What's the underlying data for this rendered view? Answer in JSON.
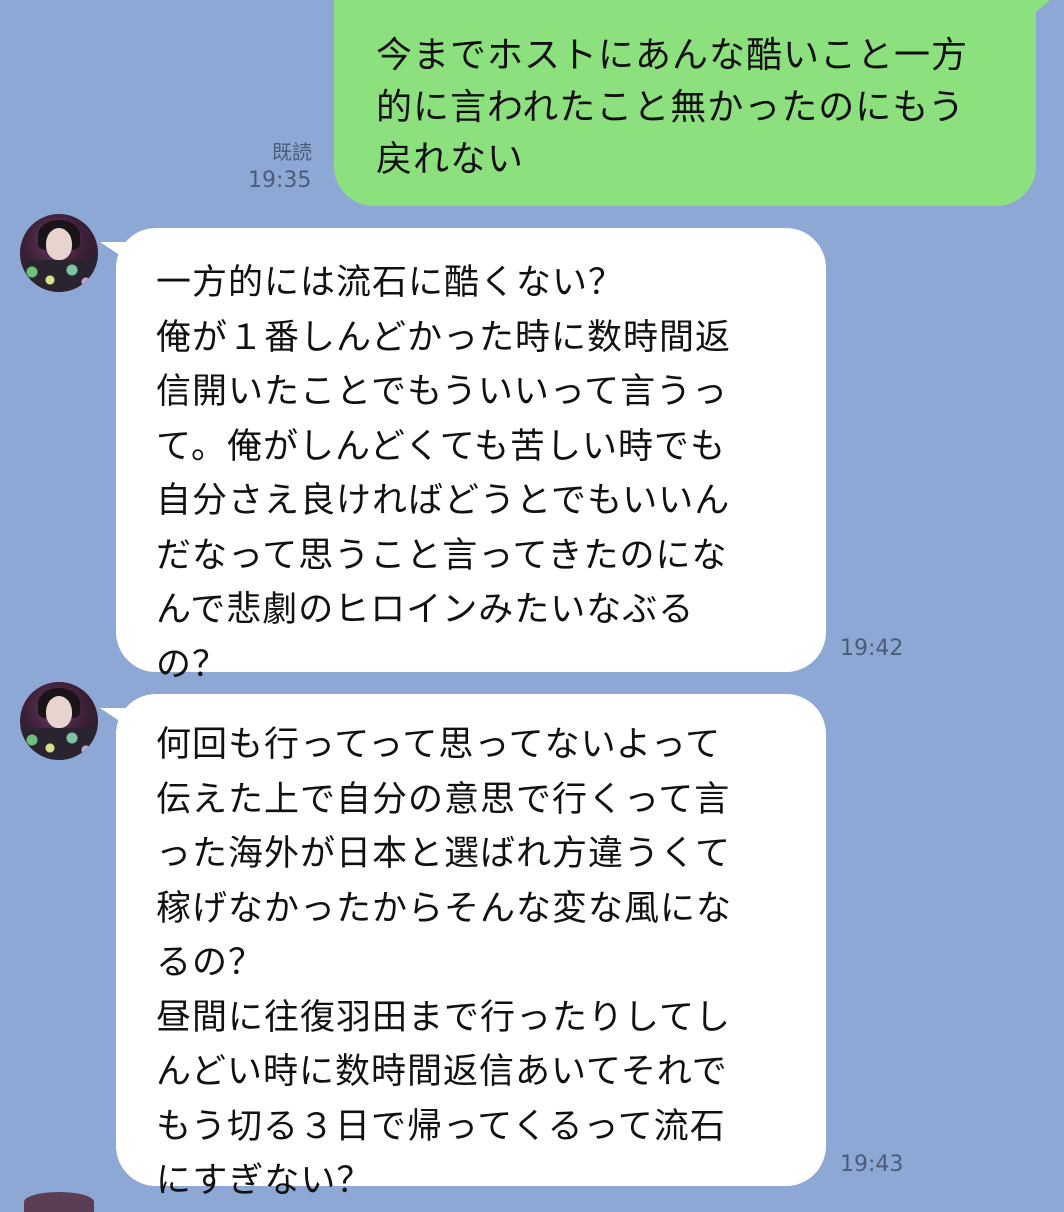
{
  "messages": [
    {
      "side": "sent",
      "text": "今までホストにあんな酷いこと一方\n的に言われたこと無かったのにもう\n戻れない",
      "read_label": "既読",
      "time": "19:35",
      "bubble_color": "#8de07e"
    },
    {
      "side": "received",
      "avatar_icon": "avatar-photo-icon",
      "text": "一方的には流石に酷くない？\n俺が１番しんどかった時に数時間返\n信開いたことでもういいって言うっ\nて。俺がしんどくても苦しい時でも\n自分さえ良ければどうとでもいいん\nだなって思うこと言ってきたのにな\nんで悲劇のヒロインみたいなぶる\nの？",
      "time": "19:42",
      "bubble_color": "#ffffff"
    },
    {
      "side": "received",
      "avatar_icon": "avatar-photo-icon",
      "text": "何回も行ってって思ってないよって\n伝えた上で自分の意思で行くって言\nった海外が日本と選ばれ方違うくて\n稼げなかったからそんな変な風にな\nるの？\n昼間に往復羽田まで行ったりしてし\nんどい時に数時間返信あいてそれで\nもう切る３日で帰ってくるって流石\nにすぎない？",
      "time": "19:43",
      "bubble_color": "#ffffff"
    }
  ],
  "theme": {
    "background": "#8ea8d6",
    "meta_text_color": "#4b5b78"
  }
}
